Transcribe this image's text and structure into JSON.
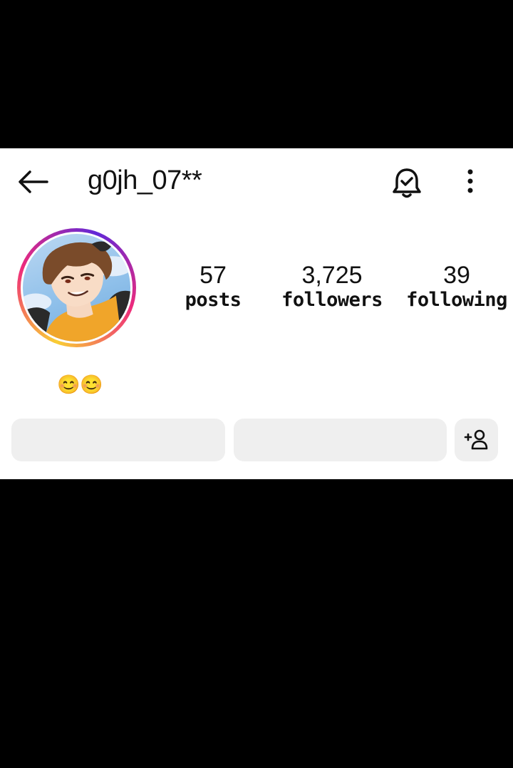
{
  "header": {
    "back_icon": "arrow-left-icon",
    "username": "g0jh_07**",
    "notification_icon": "bell-check-icon",
    "more_icon": "more-vertical-icon"
  },
  "profile": {
    "avatar_icon": "anime-character-avatar",
    "stats": [
      {
        "value": "57",
        "label": "posts"
      },
      {
        "value": "3,725",
        "label": "followers"
      },
      {
        "value": "39",
        "label": "following"
      }
    ],
    "bio": "😊😊"
  },
  "actions": {
    "add_user_icon": "add-person-icon"
  },
  "colors": {
    "background": "#000000",
    "panel": "#ffffff",
    "button_bg": "#efefef",
    "text": "#111111"
  }
}
